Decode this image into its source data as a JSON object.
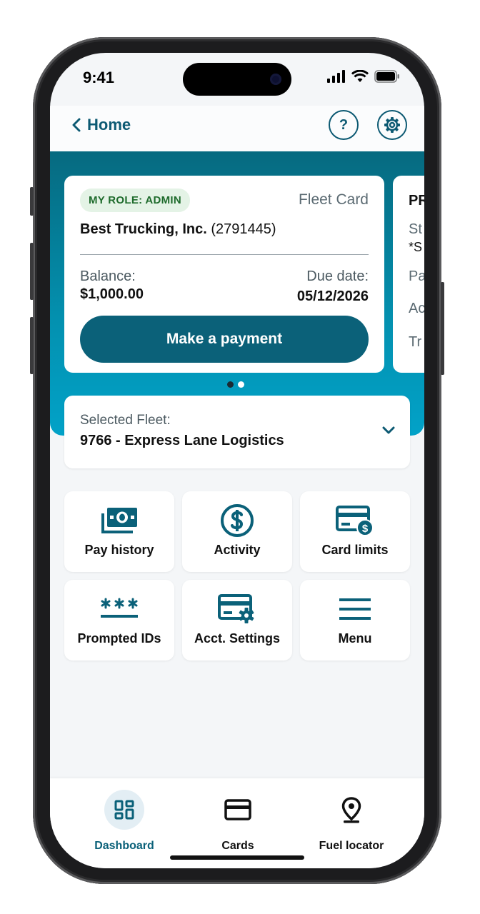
{
  "status_bar": {
    "time": "9:41"
  },
  "header": {
    "back_label": "Home",
    "help_label": "?"
  },
  "account_card": {
    "role_badge": "MY ROLE: ADMIN",
    "card_type": "Fleet Card",
    "company_name": "Best Trucking, Inc.",
    "account_number": "(2791445)",
    "balance_label": "Balance:",
    "balance_value": "$1,000.00",
    "due_label": "Due date:",
    "due_value": "05/12/2026",
    "pay_button": "Make a payment"
  },
  "peek_card": {
    "title": "PR",
    "line1": "St",
    "line2": "*S",
    "line3": "Pa",
    "line4": "Ac",
    "line5": "Tr"
  },
  "carousel": {
    "total": 2,
    "active": 1
  },
  "fleet_selector": {
    "label": "Selected Fleet:",
    "value": "9766 - Express Lane Logistics"
  },
  "quick_actions": [
    {
      "label": "Pay history",
      "icon": "cash-icon"
    },
    {
      "label": "Activity",
      "icon": "dollar-circle-icon"
    },
    {
      "label": "Card limits",
      "icon": "card-dollar-icon"
    },
    {
      "label": "Prompted IDs",
      "icon": "asterisks-icon"
    },
    {
      "label": "Acct. Settings",
      "icon": "card-gear-icon"
    },
    {
      "label": "Menu",
      "icon": "hamburger-icon"
    }
  ],
  "tab_bar": [
    {
      "label": "Dashboard",
      "icon": "dashboard-icon",
      "active": true
    },
    {
      "label": "Cards",
      "icon": "card-icon",
      "active": false
    },
    {
      "label": "Fuel locator",
      "icon": "location-pin-icon",
      "active": false
    }
  ],
  "colors": {
    "primary": "#0b6179",
    "accent": "#02a2c8",
    "role_badge_bg": "#e4f3e6",
    "role_badge_text": "#1e6b2c"
  }
}
